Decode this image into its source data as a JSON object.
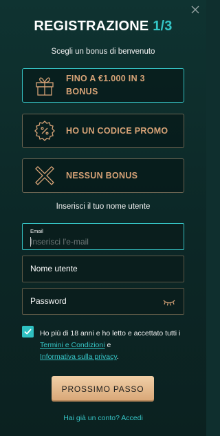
{
  "modal": {
    "title": "REGISTRAZIONE",
    "step": "1/3",
    "bonus_prompt": "Scegli un bonus di benvenuto",
    "bonus_options": [
      {
        "label_line1": "FINO A €1.000 IN 3",
        "label_line2": "BONUS",
        "icon": "gift-icon",
        "selected": true
      },
      {
        "label_line1": "HO UN CODICE PROMO",
        "icon": "percent-badge-icon",
        "selected": false
      },
      {
        "label_line1": "NESSUN BONUS",
        "icon": "x-icon",
        "selected": false
      }
    ],
    "username_prompt": "Inserisci il tuo nome utente",
    "email": {
      "label": "Email",
      "placeholder": "Inserisci l'e-mail",
      "value": ""
    },
    "username": {
      "label": "Nome utente",
      "value": ""
    },
    "password": {
      "label": "Password",
      "value": ""
    },
    "terms": {
      "checked": true,
      "text": "Ho più di 18 anni e ho letto e accettato tutti i",
      "link1": "Termini e Condizioni",
      "connector": "e",
      "link2": "Informativa sulla privacy",
      "end": "."
    },
    "next_button": "PROSSIMO PASSO",
    "login_link": "Hai già un conto? Accedi"
  },
  "colors": {
    "accent": "#35c2c3",
    "gold": "#d7a377",
    "background": "#0f3331"
  }
}
